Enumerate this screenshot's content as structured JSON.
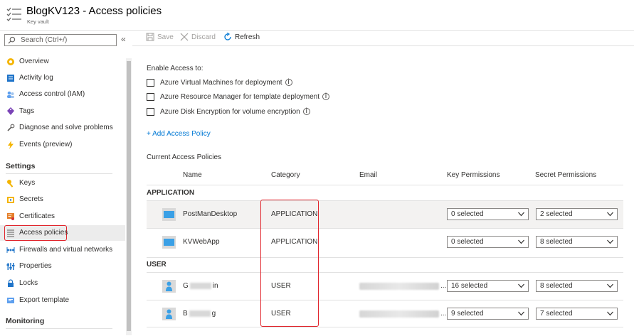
{
  "header": {
    "title": "BlogKV123 - Access policies",
    "subtitle": "Key vault"
  },
  "sidebar": {
    "search_placeholder": "Search (Ctrl+/)",
    "collapse": "«",
    "items": [
      {
        "label": "Overview"
      },
      {
        "label": "Activity log"
      },
      {
        "label": "Access control (IAM)"
      },
      {
        "label": "Tags"
      },
      {
        "label": "Diagnose and solve problems"
      },
      {
        "label": "Events (preview)"
      }
    ],
    "settings_heading": "Settings",
    "settings_items": [
      {
        "label": "Keys"
      },
      {
        "label": "Secrets"
      },
      {
        "label": "Certificates"
      },
      {
        "label": "Access policies"
      },
      {
        "label": "Firewalls and virtual networks"
      },
      {
        "label": "Properties"
      },
      {
        "label": "Locks"
      },
      {
        "label": "Export template"
      }
    ],
    "monitoring_heading": "Monitoring"
  },
  "toolbar": {
    "save": "Save",
    "discard": "Discard",
    "refresh": "Refresh"
  },
  "main": {
    "enable_label": "Enable Access to:",
    "options": [
      "Azure Virtual Machines for deployment",
      "Azure Resource Manager for template deployment",
      "Azure Disk Encryption for volume encryption"
    ],
    "add_policy": "+ Add Access Policy",
    "current_policies": "Current Access Policies",
    "columns": {
      "name": "Name",
      "category": "Category",
      "email": "Email",
      "key_permissions": "Key Permissions",
      "secret_permissions": "Secret Permissions"
    },
    "groups": {
      "application": "APPLICATION",
      "user": "USER"
    },
    "rows": [
      {
        "name": "PostManDesktop",
        "category": "APPLICATION",
        "key": "0 selected",
        "secret": "2 selected"
      },
      {
        "name": "KVWebApp",
        "category": "APPLICATION",
        "key": "0 selected",
        "secret": "8 selected"
      },
      {
        "name_prefix": "G",
        "name_suffix": "in",
        "category": "USER",
        "key": "16 selected",
        "secret": "8 selected"
      },
      {
        "name_prefix": "B",
        "name_suffix": "g",
        "category": "USER",
        "key": "9 selected",
        "secret": "7 selected"
      }
    ],
    "email_ellipsis": "..."
  },
  "colors": {
    "accent": "#0078d4",
    "highlight": "#e0242b"
  }
}
